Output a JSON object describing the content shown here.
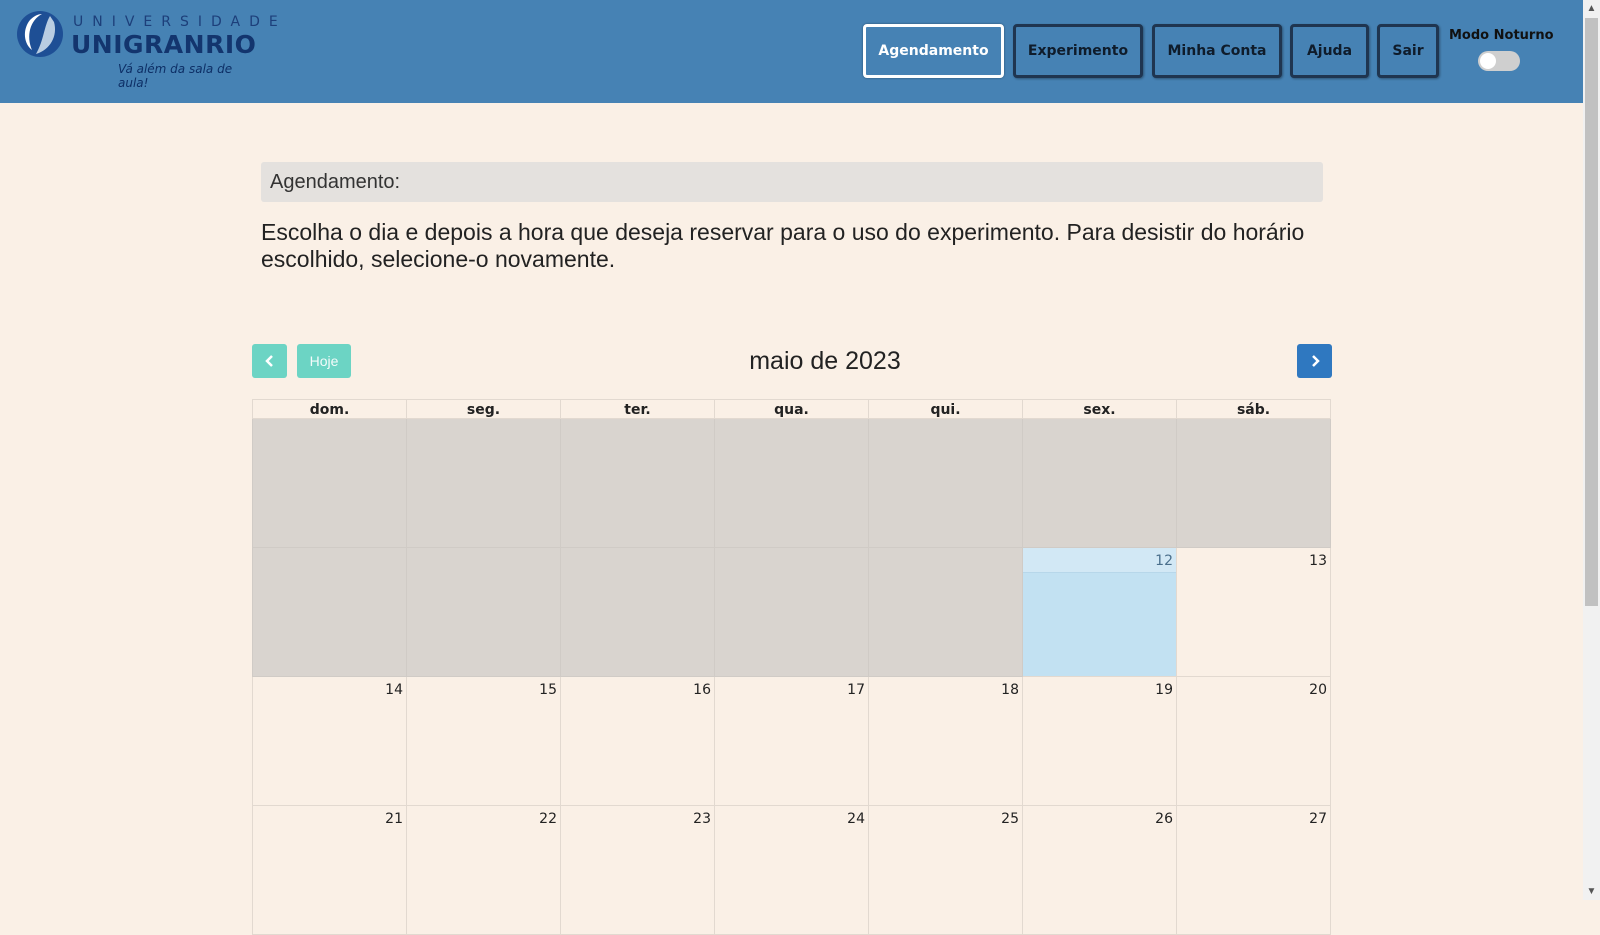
{
  "brand": {
    "top": "UNIVERSIDADE",
    "name": "UNIGRANRIO",
    "tagline": "Vá além da sala de aula!"
  },
  "nav": [
    {
      "label": "Agendamento",
      "active": true
    },
    {
      "label": "Experimento",
      "active": false
    },
    {
      "label": "Minha Conta",
      "active": false
    },
    {
      "label": "Ajuda",
      "active": false
    },
    {
      "label": "Sair",
      "active": false
    }
  ],
  "night_mode": {
    "label": "Modo Noturno",
    "enabled": false
  },
  "section": {
    "header": "Agendamento:",
    "instructions": "Escolha o dia e depois a hora que deseja reservar para o uso do experimento. Para desistir do horário escolhido, selecione-o novamente."
  },
  "calendar": {
    "title": "maio de 2023",
    "today_label": "Hoje",
    "weekdays": [
      "dom.",
      "seg.",
      "ter.",
      "qua.",
      "qui.",
      "sex.",
      "sáb."
    ],
    "weeks": [
      [
        "",
        "",
        "",
        "",
        "",
        "",
        ""
      ],
      [
        "",
        "",
        "",
        "",
        "",
        "12",
        "13"
      ],
      [
        "14",
        "15",
        "16",
        "17",
        "18",
        "19",
        "20"
      ],
      [
        "21",
        "22",
        "23",
        "24",
        "25",
        "26",
        "27"
      ]
    ],
    "today": "12",
    "colors": {
      "prev": "#6cd4c4",
      "next": "#2f78c0",
      "today_bg": "#c2e1f2",
      "disabled_bg": "#d9d4cf"
    }
  }
}
